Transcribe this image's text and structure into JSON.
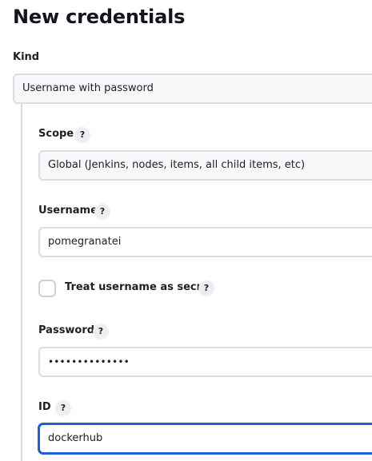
{
  "page": {
    "title": "New credentials"
  },
  "kind": {
    "label": "Kind",
    "value": "Username with password"
  },
  "scope": {
    "label": "Scope",
    "help": "?",
    "value": "Global (Jenkins, nodes, items, all child items, etc)"
  },
  "username": {
    "label": "Username",
    "help": "?",
    "value": "pomegranatei"
  },
  "treat_secret": {
    "label": "Treat username as secret",
    "help": "?",
    "checked": false
  },
  "password": {
    "label": "Password",
    "help": "?",
    "value": "••••••••••••••"
  },
  "id": {
    "label": "ID",
    "help": "?",
    "value": "dockerhub"
  },
  "colors": {
    "focus_border": "#1f5fd1",
    "field_border": "#dcdce2",
    "help_bg": "#eeeef2"
  },
  "icons": {
    "help": "question-mark-help-icon"
  }
}
